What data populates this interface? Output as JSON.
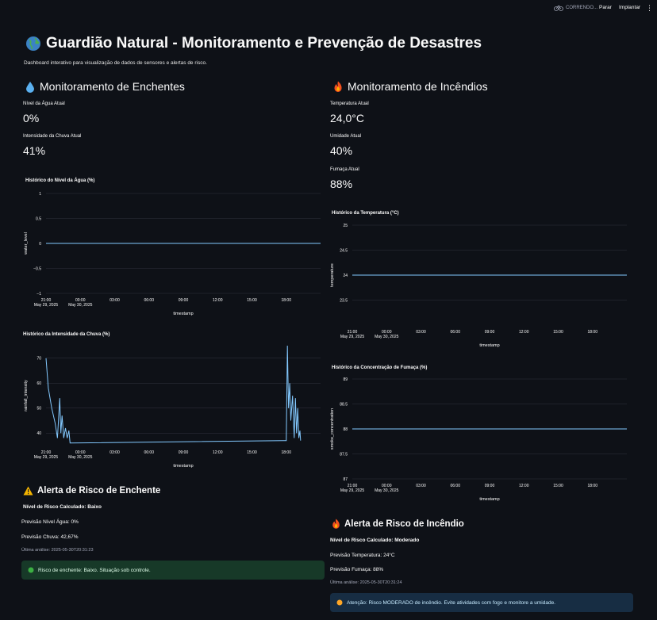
{
  "topbar": {
    "status_label": "CORRENDO...",
    "stop_label": "Parar",
    "deploy_label": "Implantar",
    "menu_glyph": "⋮"
  },
  "header": {
    "title": "Guardião Natural - Monitoramento e Prevenção de Desastres",
    "caption": "Dashboard interativo para visualização de dados de sensores e alertas de risco.",
    "icon": "globe-icon"
  },
  "flood": {
    "heading": "Monitoramento de Enchentes",
    "icon": "droplet-icon",
    "metrics": [
      {
        "label": "Nível da Água Atual",
        "value": "0%"
      },
      {
        "label": "Intensidade da Chuva Atual",
        "value": "41%"
      }
    ],
    "alert": {
      "heading": "Alerta de Risco de Enchente",
      "icon": "warning-icon",
      "risk_line": "Nível de Risco Calculado: Baixo",
      "pred_level": "Previsão Nível Água: 0%",
      "pred_rain": "Previsão Chuva: 42,67%",
      "last": "Última análise: 2025-05-30T20:31:23",
      "box_text": "Risco de enchente: Baixo. Situação sob controle.",
      "box_icon": "green-circle-icon",
      "box_color": "#173928"
    }
  },
  "fire": {
    "heading": "Monitoramento de Incêndios",
    "icon": "fire-icon",
    "metrics": [
      {
        "label": "Temperatura Atual",
        "value": "24,0°C"
      },
      {
        "label": "Umidade Atual",
        "value": "40%"
      },
      {
        "label": "Fumaça Atual",
        "value": "88%"
      }
    ],
    "alert": {
      "heading": "Alerta de Risco de Incêndio",
      "icon": "fire-icon",
      "risk_line": "Nível de Risco Calculado: Moderado",
      "pred_temp": "Previsão Temperatura: 24°C",
      "pred_smoke": "Previsão Fumaça: 88%",
      "last": "Última análise: 2025-05-30T20:31:24",
      "box_text": "Atenção: Risco MODERADO de incêndio. Evite atividades com fogo e monitore a umidade.",
      "box_icon": "orange-circle-icon",
      "box_color": "#172d43"
    }
  },
  "colors": {
    "series": "#83c9ff",
    "background": "#0e1117",
    "grid": "#31333f"
  },
  "chart_data": [
    {
      "id": "water",
      "type": "line",
      "title": "Histórico do Nível da Água (%)",
      "xlabel": "timestamp",
      "ylabel": "water_level",
      "x_ticks": [
        "21:00\nMay 29, 2025",
        "00:00\nMay 30, 2025",
        "03:00",
        "06:00",
        "09:00",
        "12:00",
        "15:00",
        "18:00"
      ],
      "y_ticks": [
        "1",
        "0.5",
        "0",
        "−0.5",
        "−1"
      ],
      "ylim": [
        -1,
        1
      ],
      "x_hours": [
        0,
        24
      ],
      "points": [
        [
          0,
          0
        ],
        [
          24,
          0
        ]
      ],
      "grid": true
    },
    {
      "id": "rain",
      "type": "line",
      "title": "Histórico da Intensidade da Chuva (%)",
      "xlabel": "timestamp",
      "ylabel": "rainfall_intensity",
      "x_ticks": [
        "21:00\nMay 29, 2025",
        "00:00\nMay 30, 2025",
        "03:00",
        "06:00",
        "09:00",
        "12:00",
        "15:00",
        "18:00"
      ],
      "y_ticks": [
        "70",
        "60",
        "50",
        "40"
      ],
      "ylim": [
        35,
        75
      ],
      "x_hours": [
        0,
        23.6
      ],
      "points": [
        [
          0,
          70
        ],
        [
          0.2,
          58
        ],
        [
          0.5,
          50
        ],
        [
          0.8,
          44
        ],
        [
          1.0,
          38
        ],
        [
          1.2,
          54
        ],
        [
          1.3,
          40
        ],
        [
          1.4,
          47
        ],
        [
          1.55,
          38
        ],
        [
          1.7,
          42
        ],
        [
          1.85,
          38
        ],
        [
          2.0,
          41
        ],
        [
          2.1,
          36
        ],
        [
          20.7,
          37
        ],
        [
          21.0,
          37
        ],
        [
          21.1,
          75
        ],
        [
          21.2,
          50
        ],
        [
          21.3,
          60
        ],
        [
          21.4,
          45
        ],
        [
          21.55,
          55
        ],
        [
          21.7,
          38
        ],
        [
          21.8,
          54
        ],
        [
          21.9,
          40
        ],
        [
          22.0,
          50
        ],
        [
          22.1,
          38
        ],
        [
          22.2,
          41
        ],
        [
          22.25,
          37
        ]
      ],
      "grid": true
    },
    {
      "id": "temperature",
      "type": "line",
      "title": "Histórico da Temperatura (°C)",
      "xlabel": "timestamp",
      "ylabel": "temperature",
      "x_ticks": [
        "21:00\nMay 29, 2025",
        "00:00\nMay 30, 2025",
        "03:00",
        "06:00",
        "09:00",
        "12:00",
        "15:00",
        "18:00"
      ],
      "y_ticks": [
        "25",
        "24.5",
        "24",
        "23.5"
      ],
      "ylim": [
        23,
        25
      ],
      "x_hours": [
        0,
        24
      ],
      "points": [
        [
          0,
          24
        ],
        [
          24,
          24
        ]
      ],
      "grid": true
    },
    {
      "id": "smoke",
      "type": "line",
      "title": "Histórico da Concentração de Fumaça (%)",
      "xlabel": "timestamp",
      "ylabel": "smoke_concentration",
      "x_ticks": [
        "21:00\nMay 29, 2025",
        "00:00\nMay 30, 2025",
        "03:00",
        "06:00",
        "09:00",
        "12:00",
        "15:00",
        "18:00"
      ],
      "y_ticks": [
        "89",
        "88.5",
        "88",
        "87.5",
        "87"
      ],
      "ylim": [
        87,
        89
      ],
      "x_hours": [
        0,
        24
      ],
      "points": [
        [
          0,
          88
        ],
        [
          24,
          88
        ]
      ],
      "grid": true
    }
  ]
}
